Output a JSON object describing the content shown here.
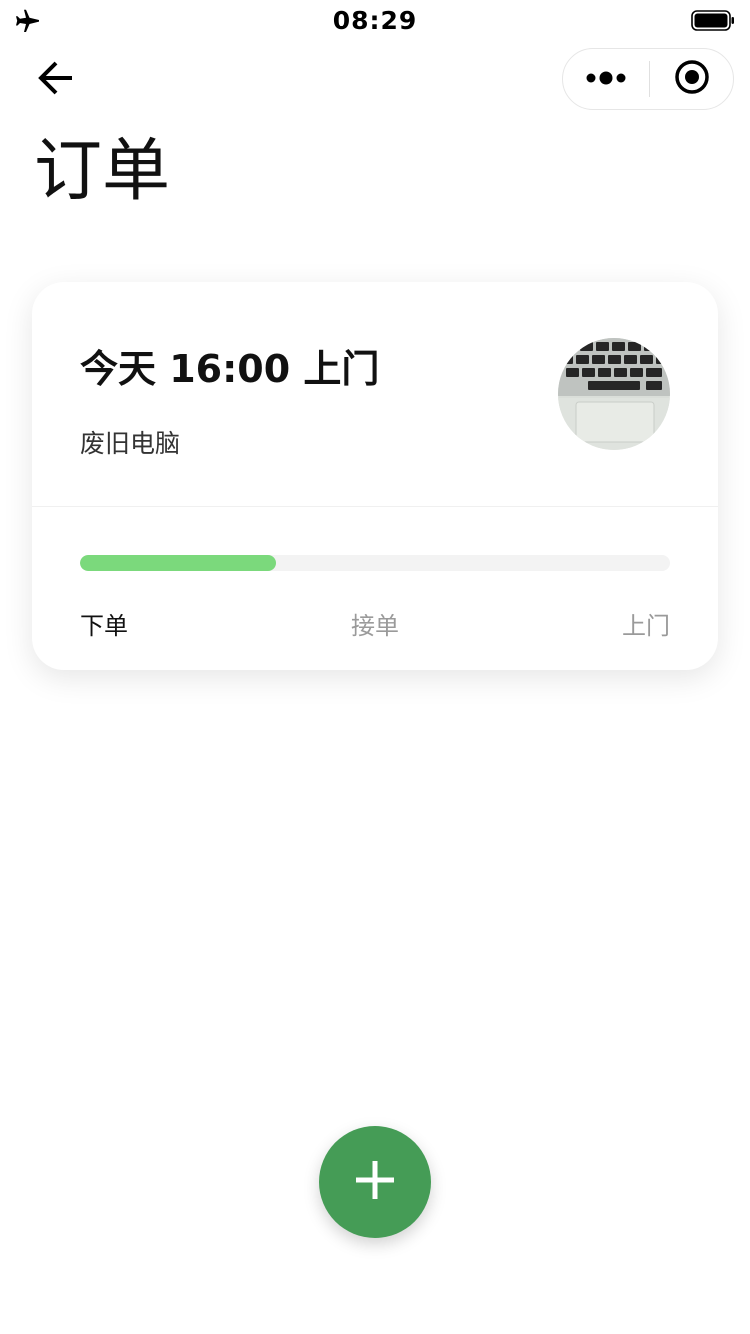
{
  "status_bar": {
    "time": "08:29",
    "icons": [
      "airplane-icon",
      "battery-icon"
    ]
  },
  "nav": {
    "back_icon": "arrow-left-icon",
    "more_icon": "more-dots-icon",
    "close_icon": "target-circle-icon",
    "title": "订单"
  },
  "order": {
    "time_label": "今天 16:00 上门",
    "item_name": "废旧电脑",
    "thumbnail": "laptop-keyboard-photo",
    "progress": 0.333,
    "steps": [
      {
        "label": "下单",
        "state": "done"
      },
      {
        "label": "接单",
        "state": "pending"
      },
      {
        "label": "上门",
        "state": "pending"
      }
    ]
  },
  "fab": {
    "icon": "plus-icon"
  },
  "colors": {
    "progress": "#7bd97c",
    "track": "#f3f3f3",
    "fab": "#459c56",
    "muted_text": "#9a9a9a"
  }
}
